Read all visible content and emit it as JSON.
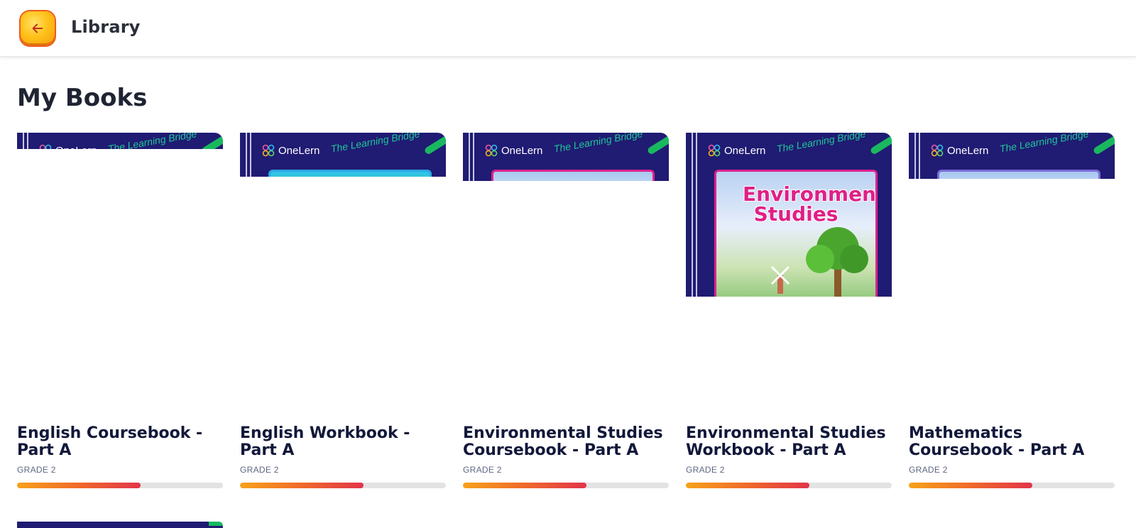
{
  "header": {
    "title": "Library",
    "back_icon": "arrow-left-icon"
  },
  "section": {
    "title": "My Books"
  },
  "cover_branding": {
    "brand": "OneLern",
    "tagline": "The Learning Bridge"
  },
  "books": [
    {
      "title": "English Coursebook - Part A",
      "grade": "GRADE 2",
      "progress": 0.6
    },
    {
      "title": "English Workbook - Part A",
      "grade": "GRADE 2",
      "progress": 0.6
    },
    {
      "title": "Environmental Studies Coursebook - Part A",
      "grade": "GRADE 2",
      "progress": 0.6
    },
    {
      "title": "Environmental Studies Workbook - Part A",
      "grade": "GRADE 2",
      "progress": 0.6,
      "cover_title": "Environmental Studies"
    },
    {
      "title": "Mathematics Coursebook - Part A",
      "grade": "GRADE 2",
      "progress": 0.6
    }
  ],
  "colors": {
    "cover_bg": "#201b73",
    "accent_green": "#1fc796",
    "progress_start": "#f7a21a",
    "progress_end": "#e2344a",
    "back_button": "#ffc21a"
  }
}
